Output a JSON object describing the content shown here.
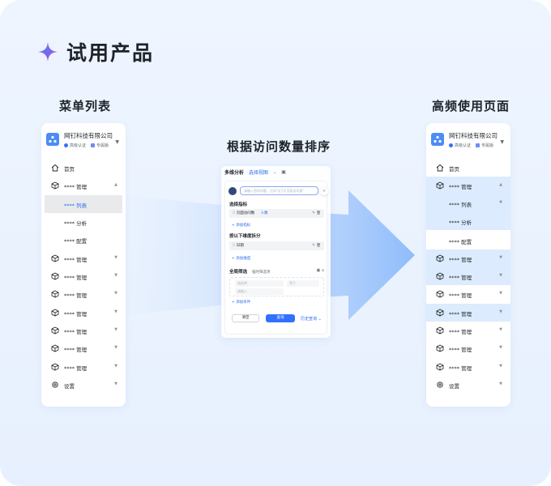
{
  "title": "试用产品",
  "sections": {
    "menu_list": "菜单列表",
    "sort_by_visits": "根据访问数量排序",
    "frequent_pages": "高频使用页面"
  },
  "company": {
    "name": "网钉科技有限公司",
    "badge_advanced": "高级认证",
    "badge_dedicated": "专属版"
  },
  "left_menu": {
    "home": "首页",
    "manage": "**** 管理",
    "list": "**** 列表",
    "analysis": "**** 分析",
    "config": "**** 配置",
    "settings": "设置"
  },
  "right_menu": {
    "home": "首页",
    "manage": "**** 管理",
    "list": "**** 列表",
    "analysis": "**** 分析",
    "config": "**** 配置",
    "settings": "设置"
  },
  "analysis_panel": {
    "header_title": "多维分析",
    "header_view": "选择视图",
    "search_placeholder": "请输入您的问题，比如\"近7天页面访问量\"",
    "select_metric": "选择指标",
    "metric_field": "页面访问数",
    "metric_unit": "人数",
    "add_metric": "+ 添加指标",
    "split_dimension": "按以下维度拆分",
    "dimension_field": "日期",
    "add_dimension": "+ 添加维度",
    "global_filter": "全局筛选",
    "temp_filter": "临时筛选项",
    "filter_select_1": "请选择",
    "filter_select_2": "等于",
    "filter_input": "请输入",
    "add_condition": "+ 添加条件",
    "btn_clear": "清空",
    "btn_query": "查询",
    "history_query": "历史查询"
  },
  "colors": {
    "accent": "#3370ff",
    "highlight": "#dcebfd",
    "background": "#eaf2fe"
  }
}
